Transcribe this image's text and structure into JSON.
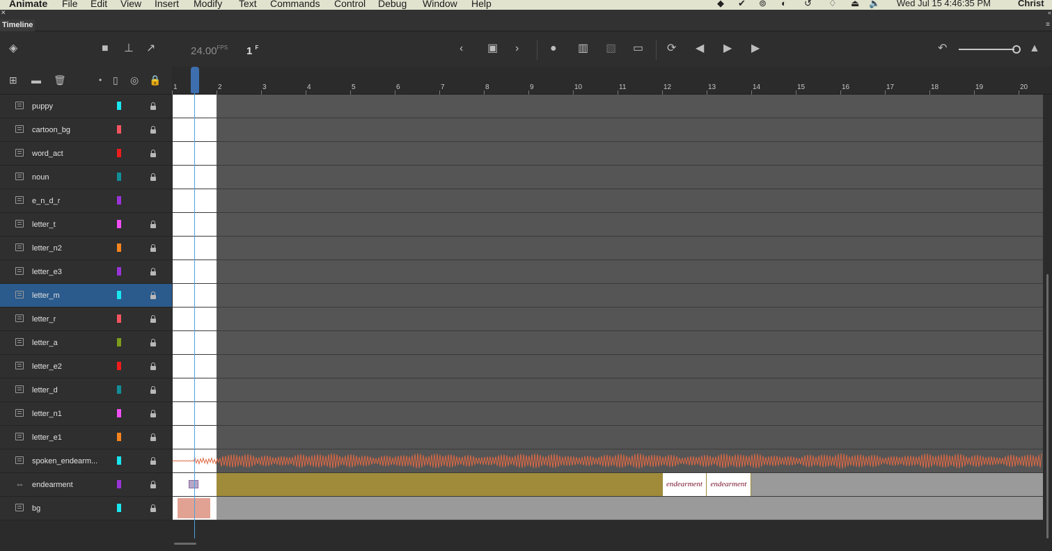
{
  "menubar": {
    "app": "Animate",
    "items": [
      "File",
      "Edit",
      "View",
      "Insert",
      "Modify",
      "Text",
      "Commands",
      "Control",
      "Debug",
      "Window",
      "Help"
    ],
    "clock": "Wed Jul 15  4:46:35 PM",
    "user": "Christ"
  },
  "panel": {
    "title": "Timeline"
  },
  "toolbar": {
    "fps_value": "24.00",
    "fps_unit": "FPS",
    "frame_value": "1",
    "frame_unit": "F"
  },
  "ruler": {
    "frames": [
      "1",
      "2",
      "3",
      "4",
      "5",
      "6",
      "7",
      "8",
      "9",
      "10",
      "11",
      "12",
      "13",
      "14",
      "15",
      "16",
      "17",
      "18",
      "19",
      "20"
    ]
  },
  "layers": [
    {
      "name": "puppy",
      "color": "#19e6f0",
      "locked": true
    },
    {
      "name": "cartoon_bg",
      "color": "#f25560",
      "locked": true
    },
    {
      "name": "word_act",
      "color": "#ee1c1c",
      "locked": true
    },
    {
      "name": "noun",
      "color": "#128e97",
      "locked": true
    },
    {
      "name": "e_n_d_r",
      "color": "#9a34d8",
      "locked": false
    },
    {
      "name": "letter_t",
      "color": "#f04ef5",
      "locked": true
    },
    {
      "name": "letter_n2",
      "color": "#f5841f",
      "locked": true
    },
    {
      "name": "letter_e3",
      "color": "#9a34d8",
      "locked": true
    },
    {
      "name": "letter_m",
      "color": "#19e6f0",
      "locked": true,
      "selected": true
    },
    {
      "name": "letter_r",
      "color": "#f25560",
      "locked": true
    },
    {
      "name": "letter_a",
      "color": "#7d9d1c",
      "locked": true
    },
    {
      "name": "letter_e2",
      "color": "#ee1c1c",
      "locked": true
    },
    {
      "name": "letter_d",
      "color": "#128e97",
      "locked": true
    },
    {
      "name": "letter_n1",
      "color": "#f04ef5",
      "locked": true
    },
    {
      "name": "letter_e1",
      "color": "#f5841f",
      "locked": true
    },
    {
      "name": "spoken_endearm...",
      "color": "#19e6f0",
      "locked": true
    },
    {
      "name": "endearment",
      "color": "#9a34d8",
      "locked": true
    },
    {
      "name": "bg",
      "color": "#19e6f0",
      "locked": true
    }
  ],
  "keyframes": {
    "endearment_label_a": "endearment",
    "endearment_label_b": "endearment"
  },
  "icons": [
    "layers-icon",
    "camera-icon",
    "hierarchy-icon",
    "graph-icon",
    "prev-icon",
    "edit-multiple-icon",
    "next-icon",
    "onion-skin-icon",
    "onion-outline-icon",
    "loop-icon",
    "rewind-icon",
    "play-icon",
    "step-forward-icon",
    "reset-zoom-icon",
    "mountains-icon",
    "new-layer-icon",
    "folder-icon",
    "trash-icon",
    "dot-icon",
    "outline-icon",
    "eye-icon",
    "lock-icon"
  ]
}
